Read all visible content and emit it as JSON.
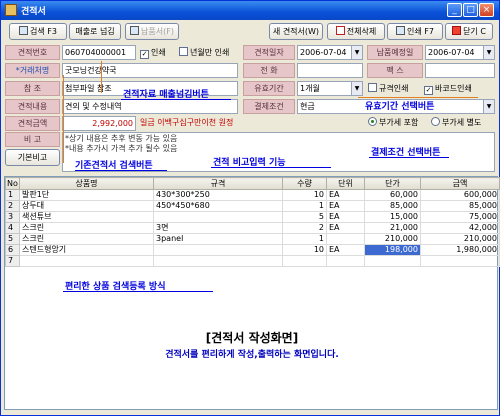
{
  "window": {
    "title": "견적서",
    "buttons": {
      "minimize": "_",
      "maximize": "□",
      "close": "×"
    }
  },
  "toolbar": {
    "search": "검색 F3",
    "transfer": "매출로 넘김",
    "delivery": "납품서(F)",
    "new": "새 견적서(W)",
    "delete_all": "전체삭제",
    "print": "인쇄 F7",
    "close": "닫기 C"
  },
  "form": {
    "labels": {
      "estimate_no": "견적번호",
      "customer": "*거래처명",
      "reference": "참 조",
      "content": "견적내용",
      "amount": "견적금액",
      "memo": "비 고",
      "memo_button": "기본비고",
      "estimate_date": "견적일자",
      "delivery_date": "납품예정일",
      "phone": "전 화",
      "fax": "팩 스",
      "validity": "유효기간",
      "payment": "결제조건"
    },
    "values": {
      "estimate_no": "060704000001",
      "customer": "굿모닝건강약국",
      "reference": "첨부파일 참조",
      "content": "견의 및 수정내역",
      "amount": "2,992,000",
      "amount_words": "일금 이백구십구만이천 원정",
      "estimate_date": "2006-07-04",
      "delivery_date": "2006-07-04",
      "phone": "",
      "fax": "",
      "validity": "1개월",
      "payment": "현금"
    },
    "checks": {
      "print": "인쇄",
      "year_only_print": "년월만 인쇄",
      "standard_print": "규격인쇄",
      "barcode_print": "바코드인쇄"
    },
    "radios": {
      "vat_included": "부가세 포함",
      "vat_separate": "부가세 별도"
    },
    "memo_lines": [
      "*상기 내용은 추후 변동 가능 있음",
      "*내용 추가시 가격 추가 될수 있음"
    ]
  },
  "annotations": {
    "sales_record": "견적자료 매출넘김버튼",
    "validity_select": "유효기간 선택버튼",
    "payment_select": "결제조건 선택버튼",
    "prev_estimate": "기존견적서 검색버튼",
    "memo_input": "견적 비고입력 기능",
    "product_search": "편리한 상품 검색등록 방식"
  },
  "table": {
    "columns": [
      "No",
      "상품명",
      "규격",
      "수량",
      "단위",
      "단가",
      "금액"
    ],
    "rows": [
      [
        "1",
        "발판1단",
        "430*300*250",
        "10",
        "EA",
        "60,000",
        "600,000"
      ],
      [
        "2",
        "상두대",
        "450*450*680",
        "1",
        "EA",
        "85,000",
        "85,000"
      ],
      [
        "3",
        "색션튜브",
        "",
        "5",
        "EA",
        "15,000",
        "75,000"
      ],
      [
        "4",
        "스크린",
        "3면",
        "2",
        "EA",
        "21,000",
        "42,000"
      ],
      [
        "5",
        "스크린",
        "3panel",
        "1",
        "",
        "210,000",
        "210,000"
      ],
      [
        "6",
        "스텐드형앙기",
        "",
        "10",
        "EA",
        "198,000",
        "1,980,000"
      ],
      [
        "7",
        "",
        "",
        "",
        "",
        "",
        ""
      ]
    ]
  },
  "caption": {
    "title": "[견적서 작성화면]",
    "subtitle": "견적서를 편리하게 작성,출력하는 화면입니다."
  },
  "colors": {
    "annotation": "#0000e0",
    "label_bg": "#e6c6c8",
    "selected_cell": "#3c6ad0"
  }
}
